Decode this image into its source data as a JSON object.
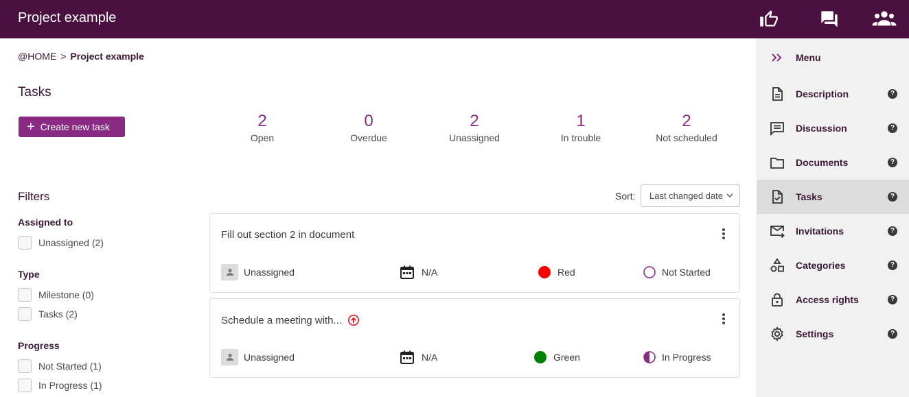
{
  "header": {
    "title": "Project example"
  },
  "breadcrumb": {
    "home": "@HOME",
    "separator": ">",
    "current": "Project example"
  },
  "page": {
    "title": "Tasks",
    "create_label": "Create new task"
  },
  "stats": [
    {
      "value": "2",
      "label": "Open"
    },
    {
      "value": "0",
      "label": "Overdue"
    },
    {
      "value": "2",
      "label": "Unassigned"
    },
    {
      "value": "1",
      "label": "In trouble"
    },
    {
      "value": "2",
      "label": "Not scheduled"
    }
  ],
  "filters": {
    "title": "Filters",
    "groups": [
      {
        "title": "Assigned to",
        "options": [
          {
            "label": "Unassigned (2)"
          }
        ]
      },
      {
        "title": "Type",
        "options": [
          {
            "label": "Milestone (0)"
          },
          {
            "label": "Tasks (2)"
          }
        ]
      },
      {
        "title": "Progress",
        "options": [
          {
            "label": "Not Started (1)"
          },
          {
            "label": "In Progress (1)"
          }
        ]
      }
    ]
  },
  "sort": {
    "label": "Sort:",
    "value": "Last changed date"
  },
  "tasks": [
    {
      "title": "Fill out section 2 in document",
      "assignee": "Unassigned",
      "date": "N/A",
      "status": "Red",
      "status_color": "#ff0000",
      "progress": "Not Started"
    },
    {
      "title": "Schedule a meeting with...",
      "assignee": "Unassigned",
      "date": "N/A",
      "status": "Green",
      "status_color": "#008000",
      "progress": "In Progress"
    }
  ],
  "sidebar": {
    "items": [
      {
        "label": "Menu",
        "icon": "double-chevron-right-icon"
      },
      {
        "label": "Description",
        "icon": "document-icon"
      },
      {
        "label": "Discussion",
        "icon": "chat-icon"
      },
      {
        "label": "Documents",
        "icon": "folder-icon"
      },
      {
        "label": "Tasks",
        "icon": "task-check-icon"
      },
      {
        "label": "Invitations",
        "icon": "mail-forward-icon"
      },
      {
        "label": "Categories",
        "icon": "shapes-icon"
      },
      {
        "label": "Access rights",
        "icon": "lock-icon"
      },
      {
        "label": "Settings",
        "icon": "gear-icon"
      }
    ]
  },
  "colors": {
    "header_bg": "#4a1140",
    "accent": "#8b2a83",
    "sidebar_bg": "#f1f1f1"
  }
}
